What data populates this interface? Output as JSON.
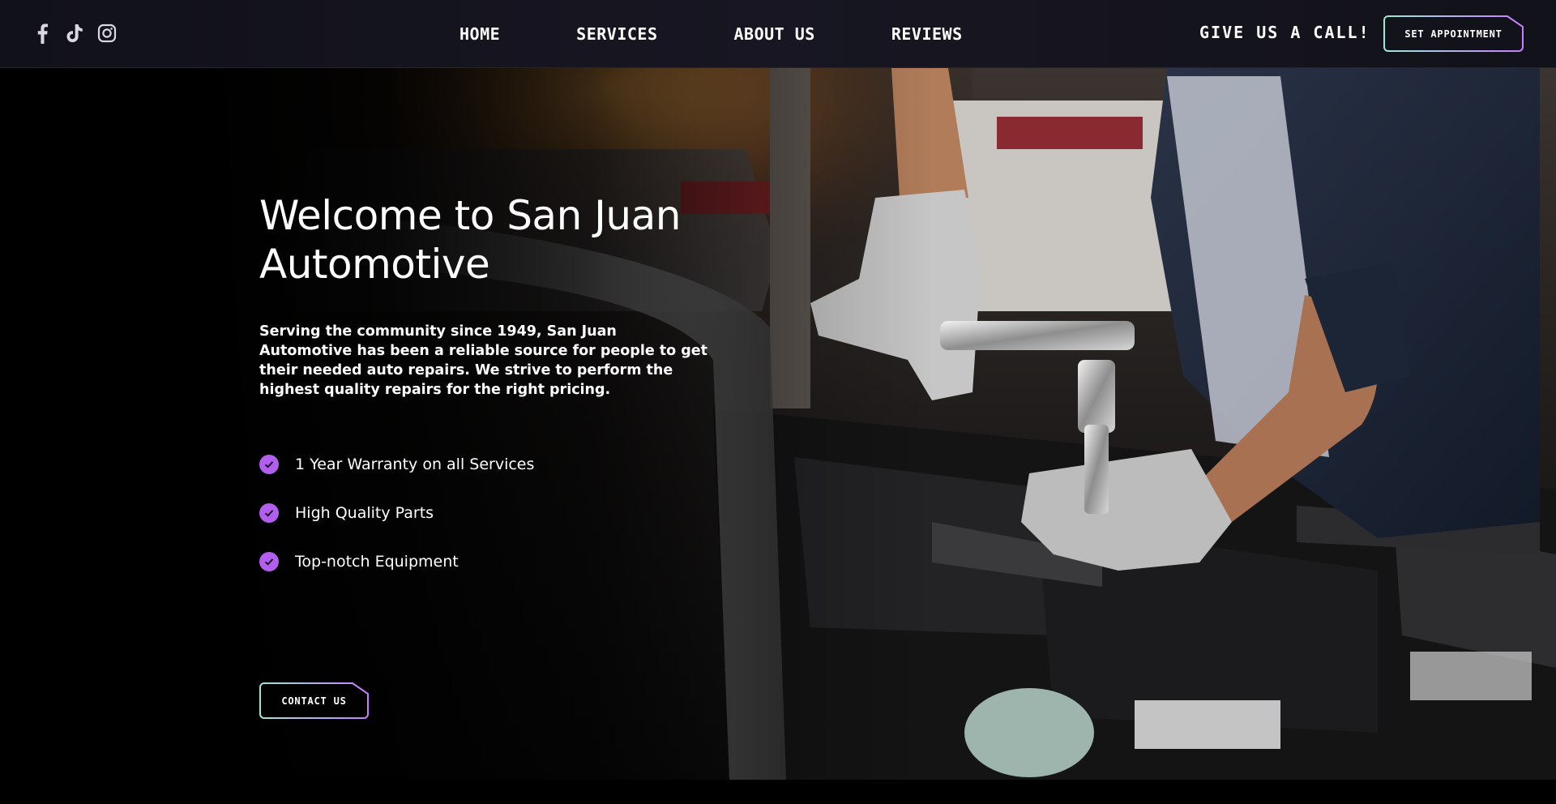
{
  "nav": {
    "social": [
      {
        "icon": "facebook-icon"
      },
      {
        "icon": "tiktok-icon"
      },
      {
        "icon": "instagram-icon"
      }
    ],
    "links": [
      "HOME",
      "SERVICES",
      "ABOUT US",
      "REVIEWS"
    ],
    "call_text": "GIVE US A CALL!",
    "appointment_label": "SET APPOINTMENT"
  },
  "hero": {
    "title_line1": "Welcome to San Juan",
    "title_line2": "Automotive",
    "description": "Serving the community since 1949, San Juan Automotive has been a reliable source for people to get their needed auto repairs. We strive to perform the highest quality repairs for the right pricing.",
    "features": [
      "1 Year Warranty on all Services",
      "High Quality Parts",
      "Top-notch Equipment"
    ],
    "contact_label": "CONTACT US"
  },
  "colors": {
    "accent": "#b25ff0",
    "nav_bg": "#15141e",
    "button_gradient_start": "#9de7d7",
    "button_gradient_end": "#c77dff"
  }
}
